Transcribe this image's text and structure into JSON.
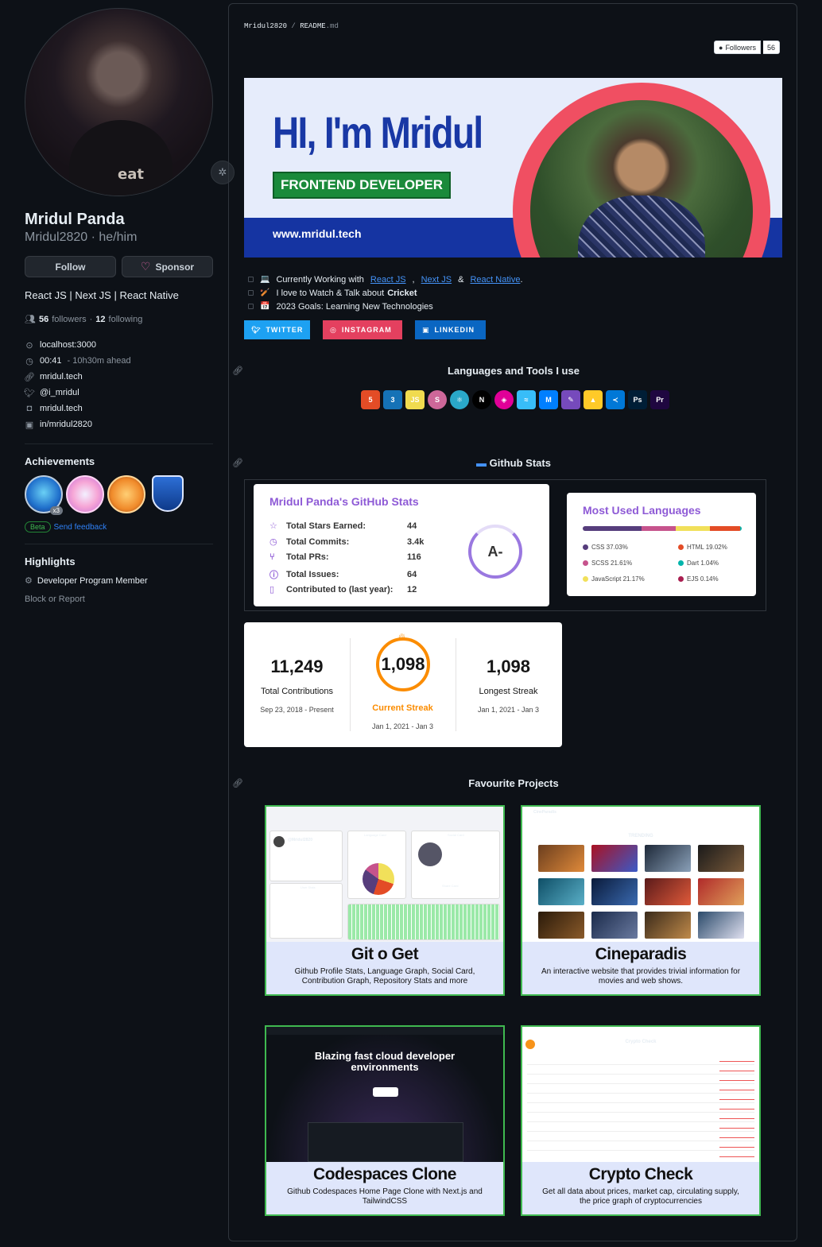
{
  "profile": {
    "name": "Mridul Panda",
    "username": "Mridul2820 · he/him",
    "follow_label": "Follow",
    "sponsor_label": "Sponsor",
    "bio": "React JS | Next JS | React Native",
    "followers_count": "56",
    "followers_word": "followers",
    "following_count": "12",
    "following_word": "following",
    "location": "localhost:3000",
    "time": "00:41",
    "time_note": "- 10h30m ahead",
    "website": "mridul.tech",
    "twitter": "@i_mridul",
    "instagram": "mridul.tech",
    "linkedin": "in/mridul2820",
    "avatar_shirt_text": "eat"
  },
  "achievements": {
    "title": "Achievements",
    "badge_multiplier": "x3",
    "beta_label": "Beta",
    "feedback_label": "Send feedback"
  },
  "highlights": {
    "title": "Highlights",
    "item": "Developer Program Member",
    "block_label": "Block or Report"
  },
  "readme": {
    "breadcrumb_user": "Mridul2820",
    "breadcrumb_sep": "/",
    "breadcrumb_file": "README",
    "breadcrumb_ext": ".md",
    "followers_badge_label": "Followers",
    "followers_badge_count": "56",
    "banner_title": "HI, I'm Mridul",
    "banner_role": "FRONTEND DEVELOPER",
    "banner_url": "www.mridul.tech",
    "todo": {
      "line1_prefix": "Currently Working with",
      "react": "React JS",
      "next": "Next JS",
      "amp": "&",
      "native": "React Native",
      "period": ".",
      "line2_prefix": "I love to Watch & Talk about",
      "cricket": "Cricket",
      "line3": "2023 Goals: Learning New Technologies"
    },
    "social": {
      "twitter": "TWITTER",
      "instagram": "INSTAGRAM",
      "linkedin": "LINKEDIN"
    },
    "tools_heading": "Languages and Tools I use",
    "tools": [
      "HTML",
      "CSS",
      "JS",
      "Sass",
      "React",
      "N",
      "GraphQL",
      "Tailwind",
      "MUI",
      "Redux",
      "Firebase",
      "VS",
      "Ps",
      "Pr"
    ],
    "stats_heading": "Github Stats",
    "stats_card": {
      "title": "Mridul Panda's GitHub Stats",
      "rows": [
        {
          "label": "Total Stars Earned:",
          "value": "44"
        },
        {
          "label": "Total Commits:",
          "value": "3.4k"
        },
        {
          "label": "Total PRs:",
          "value": "116"
        },
        {
          "label": "Total Issues:",
          "value": "64"
        },
        {
          "label": "Contributed to (last year):",
          "value": "12"
        }
      ],
      "grade": "A-"
    },
    "languages_card": {
      "title": "Most Used Languages",
      "langs": [
        {
          "name": "CSS 37.03%",
          "color": "#563d7c",
          "pct": 37.03
        },
        {
          "name": "HTML 19.02%",
          "color": "#e34c26",
          "pct": 19.02
        },
        {
          "name": "SCSS 21.61%",
          "color": "#c6538c",
          "pct": 21.61
        },
        {
          "name": "Dart 1.04%",
          "color": "#00B4AB",
          "pct": 1.04
        },
        {
          "name": "JavaScript 21.17%",
          "color": "#f1e05a",
          "pct": 21.17
        },
        {
          "name": "EJS 0.14%",
          "color": "#a91e50",
          "pct": 0.14
        }
      ]
    },
    "streak": {
      "total": "11,249",
      "total_label": "Total Contributions",
      "total_range": "Sep 23, 2018 - Present",
      "current": "1,098",
      "current_label": "Current Streak",
      "current_range": "Jan 1, 2021 - Jan 3",
      "longest": "1,098",
      "longest_label": "Longest Streak",
      "longest_range": "Jan 1, 2021 - Jan 3"
    },
    "projects_heading": "Favourite Projects",
    "projects": [
      {
        "title": "Git o Get",
        "desc": "Github Profile Stats, Language Graph, Social Card, Contribution Graph, Repository Stats and more"
      },
      {
        "title": "Cineparadis",
        "desc": "An interactive website that provides trivial information for movies and web shows."
      },
      {
        "title": "Codespaces Clone",
        "desc": "Github Codespaces Home Page Clone with Next.js and TailwindCSS"
      },
      {
        "title": "Crypto Check",
        "desc": "Get all data about prices, market cap, circulating supply, the price graph of cryptocurrencies"
      }
    ],
    "project_shots": {
      "gitoget_user": "@Mridul2820",
      "gitoget_lang_card": "Language Card",
      "gitoget_social_card": "Social Card",
      "gitoget_user_stats": "User Stats",
      "gitoget_share_card": "Share Card",
      "cine_brand": "CineParadis",
      "cine_trending": "TRENDING",
      "codespaces_hero": "Blazing fast cloud developer environments",
      "crypto_title": "Crypto Check"
    }
  }
}
